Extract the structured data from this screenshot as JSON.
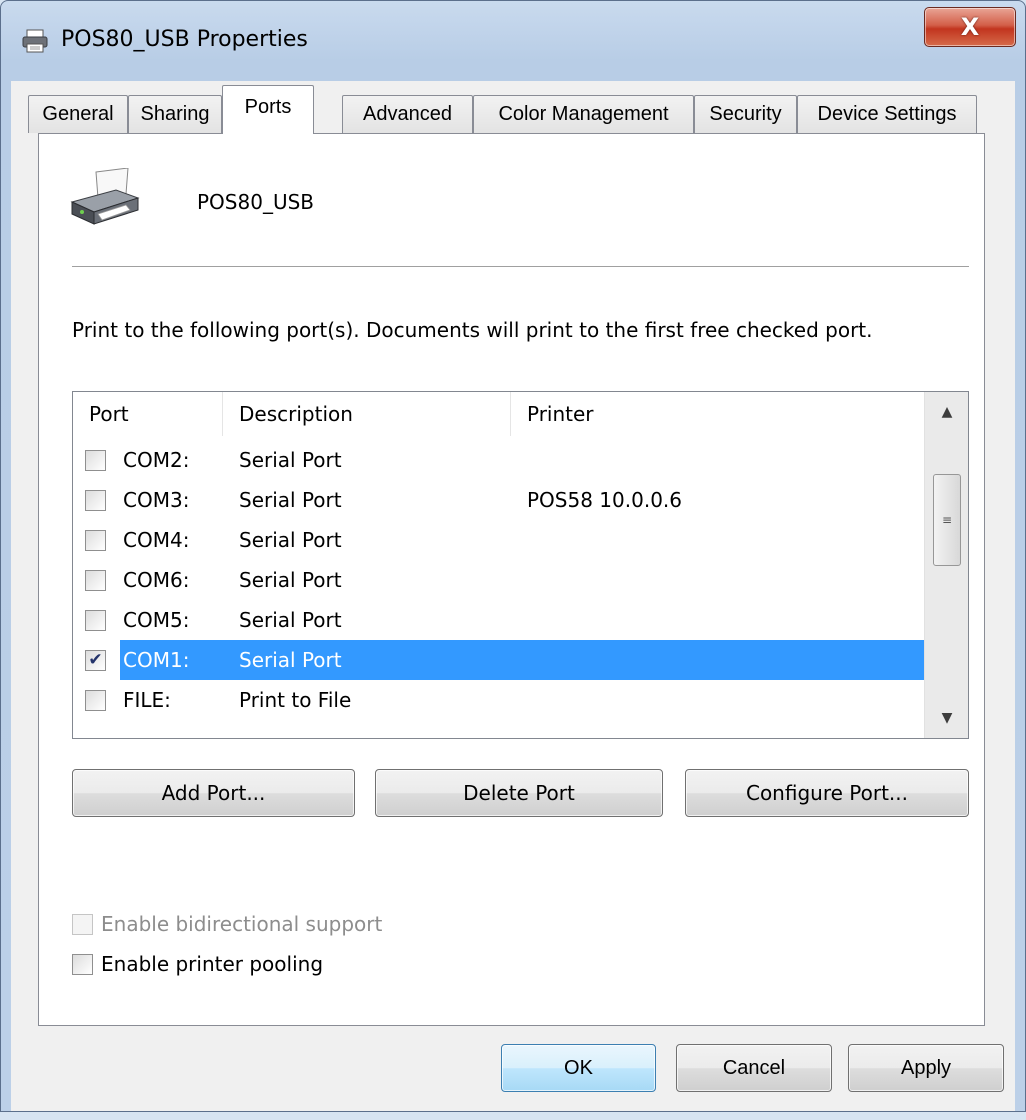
{
  "window": {
    "title": "POS80_USB Properties",
    "close_label": "X"
  },
  "tabs": [
    {
      "label": "General",
      "active": false
    },
    {
      "label": "Sharing",
      "active": false
    },
    {
      "label": "Ports",
      "active": true
    },
    {
      "label": "Advanced",
      "active": false
    },
    {
      "label": "Color Management",
      "active": false
    },
    {
      "label": "Security",
      "active": false
    },
    {
      "label": "Device Settings",
      "active": false
    }
  ],
  "printer": {
    "name": "POS80_USB",
    "icon": "printer-icon"
  },
  "ports": {
    "description": "Print to the following port(s). Documents will print to the first free checked port.",
    "columns": [
      "Port",
      "Description",
      "Printer"
    ],
    "rows": [
      {
        "port": "COM2:",
        "description": "Serial Port",
        "printer": "",
        "checked": false,
        "selected": false
      },
      {
        "port": "COM3:",
        "description": "Serial Port",
        "printer": "POS58 10.0.0.6",
        "checked": false,
        "selected": false
      },
      {
        "port": "COM4:",
        "description": "Serial Port",
        "printer": "",
        "checked": false,
        "selected": false
      },
      {
        "port": "COM6:",
        "description": "Serial Port",
        "printer": "",
        "checked": false,
        "selected": false
      },
      {
        "port": "COM5:",
        "description": "Serial Port",
        "printer": "",
        "checked": false,
        "selected": false
      },
      {
        "port": "COM1:",
        "description": "Serial Port",
        "printer": "",
        "checked": true,
        "selected": true
      },
      {
        "port": "FILE:",
        "description": "Print to File",
        "printer": "",
        "checked": false,
        "selected": false
      }
    ]
  },
  "buttons": {
    "add_port": "Add Port...",
    "delete_port": "Delete Port",
    "configure_port": "Configure Port..."
  },
  "options": {
    "bidirectional_label": "Enable bidirectional support",
    "bidirectional_checked": false,
    "bidirectional_enabled": false,
    "pooling_label": "Enable printer pooling",
    "pooling_checked": false
  },
  "dialog_buttons": {
    "ok": "OK",
    "cancel": "Cancel",
    "apply": "Apply"
  },
  "colors": {
    "selection": "#3399ff",
    "close_button": "#c2351f",
    "default_button_border": "#3c7fb1"
  }
}
